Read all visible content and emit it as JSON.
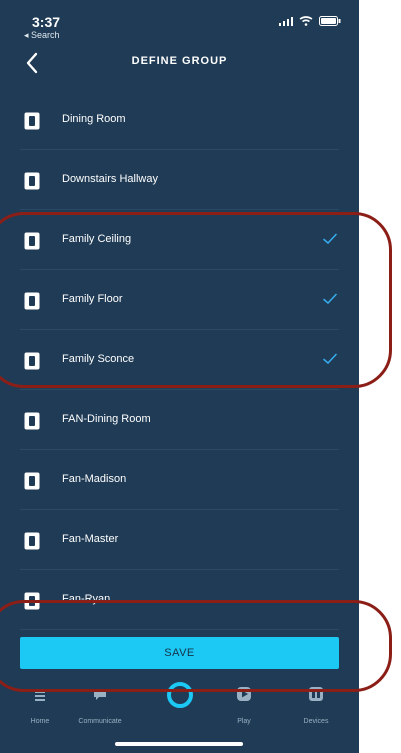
{
  "status": {
    "time": "3:37",
    "back_label": "◂ Search"
  },
  "header": {
    "title": "DEFINE GROUP"
  },
  "devices": [
    {
      "label": "Dining Room",
      "selected": false
    },
    {
      "label": "Downstairs Hallway",
      "selected": false
    },
    {
      "label": "Family Ceiling",
      "selected": true
    },
    {
      "label": "Family Floor",
      "selected": true
    },
    {
      "label": "Family Sconce",
      "selected": true
    },
    {
      "label": "FAN-Dining Room",
      "selected": false
    },
    {
      "label": "Fan-Madison",
      "selected": false
    },
    {
      "label": "Fan-Master",
      "selected": false
    },
    {
      "label": "Fan-Ryan",
      "selected": false
    }
  ],
  "save_button": {
    "label": "SAVE"
  },
  "tabs": [
    {
      "label": "Home",
      "icon": "home-icon"
    },
    {
      "label": "Communicate",
      "icon": "chat-icon"
    },
    {
      "label": "",
      "icon": "alexa-ring-icon"
    },
    {
      "label": "Play",
      "icon": "play-icon"
    },
    {
      "label": "Devices",
      "icon": "devices-icon"
    }
  ],
  "colors": {
    "background": "#1f3b55",
    "accent": "#1cc8f4",
    "check": "#36a9e8",
    "annotation": "#8b1f17"
  }
}
